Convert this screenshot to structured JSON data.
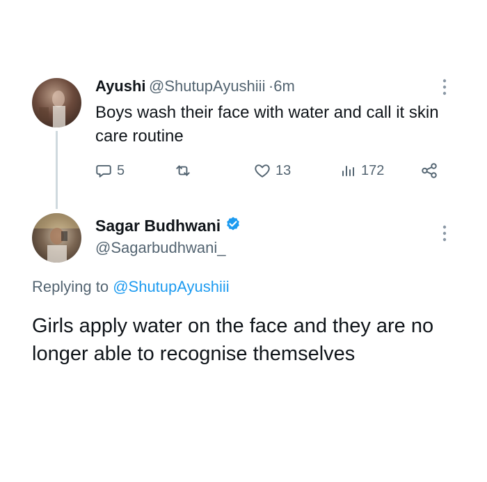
{
  "tweet1": {
    "author_name": "Ayushi",
    "author_handle": "@ShutupAyushiii",
    "separator": "·",
    "time": "6m",
    "text": "Boys wash their face with water and call it skin care routine",
    "replies": "5",
    "likes": "13",
    "views": "172",
    "icons": [
      "reply-icon",
      "retweet-icon",
      "like-icon",
      "views-icon",
      "share-icon",
      "more-icon"
    ]
  },
  "tweet2": {
    "author_name": "Sagar Budhwani",
    "author_handle": "@Sagarbudhwani_",
    "verified": true,
    "replying_prefix": "Replying to",
    "replying_handle": "@ShutupAyushiii",
    "text": "Girls apply water on the face and they are no longer able to recognise themselves"
  },
  "colors": {
    "text": "#0f1419",
    "muted": "#536471",
    "accent": "#1d9bf0",
    "thread_line": "#cfd9de"
  }
}
